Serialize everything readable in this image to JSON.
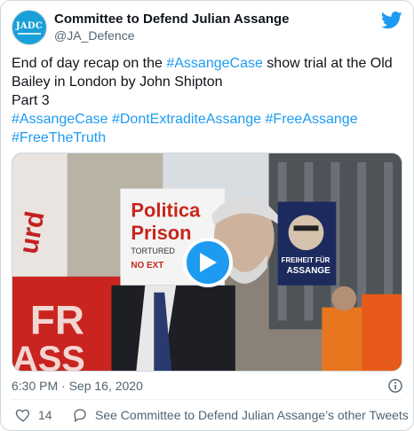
{
  "author": {
    "name": "Committee to Defend Julian Assange",
    "handle": "@JA_Defence",
    "avatar_text": "JADC"
  },
  "tweet": {
    "line1_text": "End of day recap on the ",
    "line1_tag": "#AssangeCase",
    "line1_rest": " show trial at the Old Bailey in London by John Shipton",
    "line2": "Part 3",
    "tags": [
      "#AssangeCase",
      "#DontExtraditeAssange",
      "#FreeAssange",
      "#FreeTheTruth"
    ]
  },
  "media": {
    "sign_left_line1": "Politica",
    "sign_left_line2": "Prison",
    "sign_left_small1": "TORTURED",
    "sign_left_small2": "NO EXT",
    "sign_right_line1": "FREIHEIT FÜR",
    "sign_right_line2": "ASSANGE",
    "banner_left": "FR",
    "banner_left2": "ASS"
  },
  "meta": {
    "timestamp": "6:30 PM · Sep 16, 2020"
  },
  "footer": {
    "likes": "14",
    "see_more": "See Committee to Defend Julian Assange’s other Tweets"
  },
  "icons": {
    "brand": "twitter-bird-icon",
    "play": "play-icon",
    "info": "info-icon",
    "like": "heart-icon",
    "reply": "reply-bubble-icon"
  },
  "colors": {
    "accent": "#1d9bf0",
    "text": "#0f1419",
    "muted": "#536471"
  }
}
